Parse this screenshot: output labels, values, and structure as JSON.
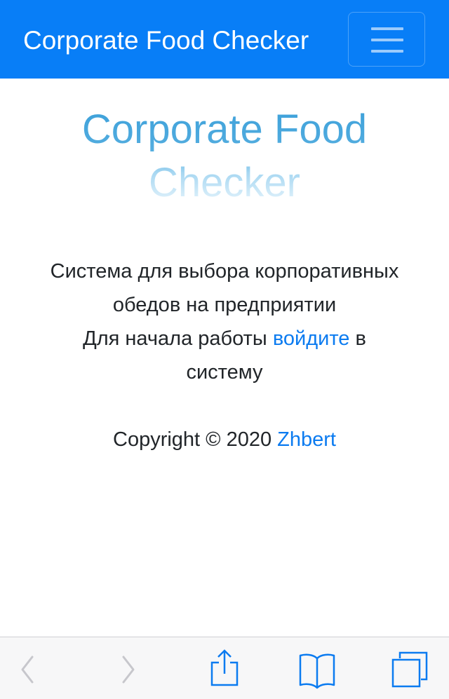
{
  "navbar": {
    "brand": "Corporate Food Checker",
    "menu_icon": "hamburger-menu-icon",
    "background_color": "#087ef7"
  },
  "hero": {
    "title_line1": "Corporate Food",
    "title_line2": "Checker"
  },
  "description": {
    "line1": "Система для выбора корпоративных",
    "line2": "обедов на предприятии",
    "line3_before": "Для начала работы ",
    "line3_link": "войдите",
    "line3_after": " в",
    "line4": "систему"
  },
  "footer": {
    "copyright_text": "Copyright © 2020 ",
    "author_link": "Zhbert"
  },
  "browser_toolbar": {
    "icons": [
      "chevron-left-icon",
      "chevron-right-icon",
      "share-icon",
      "book-icon",
      "tabs-icon"
    ],
    "accent_color": "#0b7bf0",
    "disabled_color": "#c7c7cc"
  }
}
